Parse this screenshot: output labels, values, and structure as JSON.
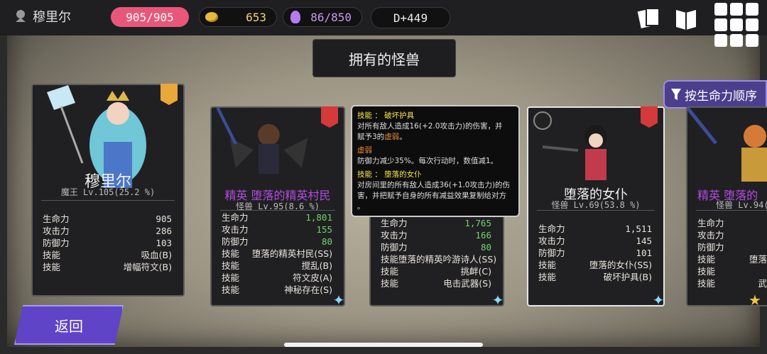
{
  "header": {
    "location": "穆里尔",
    "hp": "905/905",
    "gold": "653",
    "souls": "86/850",
    "day": "D+449"
  },
  "title": "拥有的怪兽",
  "sort_button": "按生命力顺序",
  "back_button": "返回",
  "labels": {
    "hp": "生命力",
    "atk": "攻击力",
    "def": "防御力",
    "skill": "技能"
  },
  "cards": [
    {
      "name": "穆里尔",
      "level": "魔王 Lv.105(25.2 %)",
      "hp": "905",
      "atk": "286",
      "def": "103",
      "skills": [
        "吸血(B)",
        "增幅符文(B)"
      ]
    },
    {
      "name": "精英 堕落的精英村民",
      "level": "怪兽 Lv.95(8.6 %)",
      "hp": "1,801",
      "atk": "155",
      "def": "80",
      "skills": [
        "堕落的精英村民(SS)",
        "搅乱(B)",
        "符文皮(A)",
        "神秘存在(S)"
      ]
    },
    {
      "name": "",
      "level": "",
      "hp": "1,765",
      "atk": "166",
      "def": "80",
      "skills": [
        "堕落的精英吟游诗人(SS)",
        "挑衅(C)",
        "电击武器(S)"
      ]
    },
    {
      "name": "堕落的女仆",
      "level": "怪兽 Lv.69(53.8 %)",
      "hp": "1,511",
      "atk": "145",
      "def": "101",
      "skills": [
        "堕落的女仆(SS)",
        "破坏护具(B)"
      ]
    },
    {
      "name": "精英 堕落的",
      "level": "怪兽 Lv.94(2",
      "hp": "",
      "atk": "",
      "def": "",
      "skills": [
        "堕落",
        "",
        "武"
      ]
    }
  ],
  "tooltip": {
    "skill1_title": "技能 ： 破坏护具",
    "skill1_desc_a": "对所有敌人造成16(+2.0攻击力)的伤害，并",
    "skill1_desc_b": "赋予3的",
    "skill1_highlight": "虚弱",
    "skill1_desc_c": "。",
    "status_title": "虚弱",
    "status_desc": "防御力减少35%。每次行动时，数值减1。",
    "skill2_title": "技能 ： 堕落的女仆",
    "skill2_desc_a": "对房间里的所有敌人造成36(+1.0攻击力)的伤",
    "skill2_desc_b": "害，并把赋予自身的所有减益效果复制给对方",
    "skill2_desc_c": "。"
  },
  "colors": {
    "hp_pill": "#e8577a",
    "accent": "#5f44c7",
    "elite": "#b34be2",
    "tooltip_yellow": "#f2e34d"
  }
}
